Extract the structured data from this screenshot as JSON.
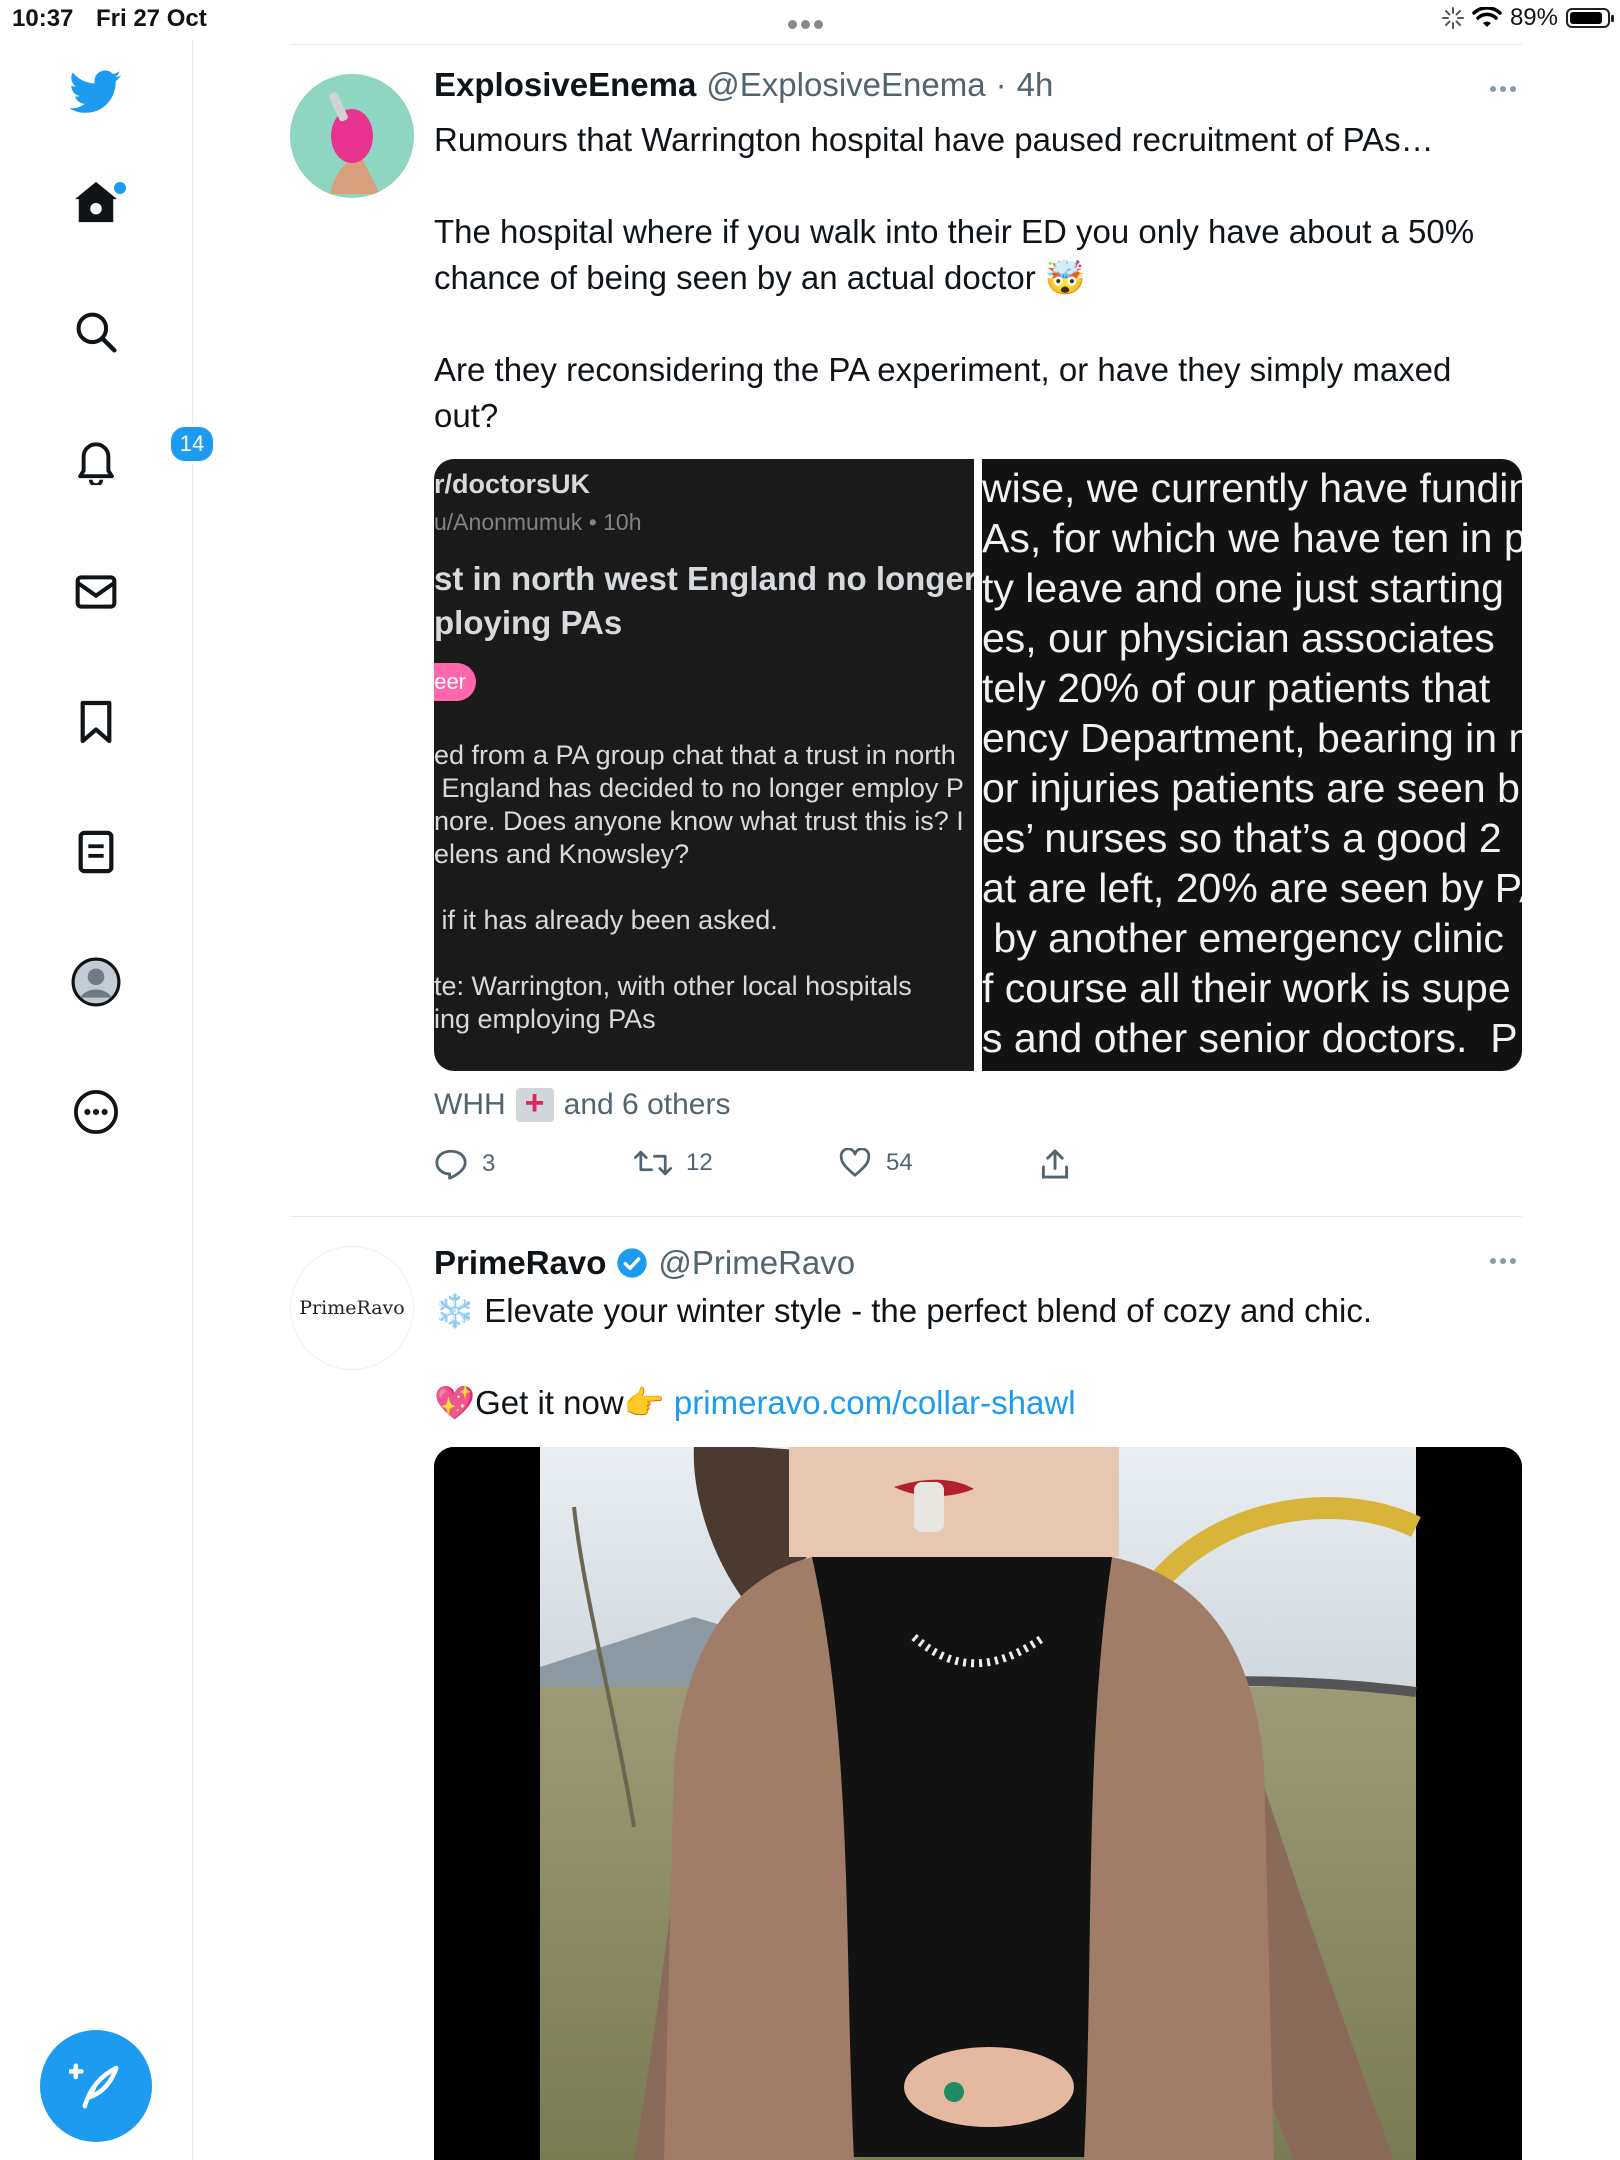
{
  "status_bar": {
    "time": "10:37",
    "date": "Fri 27 Oct",
    "battery": "89%",
    "battery_level": 0.89
  },
  "sidebar": {
    "items": [
      {
        "name": "twitter-logo-icon"
      },
      {
        "name": "home-icon"
      },
      {
        "name": "search-icon"
      },
      {
        "name": "notifications-icon",
        "badge": "14"
      },
      {
        "name": "messages-icon"
      },
      {
        "name": "bookmarks-icon"
      },
      {
        "name": "lists-icon"
      },
      {
        "name": "profile-icon"
      },
      {
        "name": "more-icon"
      }
    ],
    "accent": "#1d9bf0"
  },
  "tweets": [
    {
      "name": "ExplosiveEnema",
      "handle": "@ExplosiveEnema",
      "separator": "·",
      "time": "4h",
      "text": [
        "Rumours that Warrington hospital have paused recruitment of PAs…",
        "The hospital where if you walk into their ED you only have about a 50% chance of being seen by an actual doctor 🤯",
        "Are they reconsidering the PA experiment, or have they simply maxed out?"
      ],
      "media_left": {
        "subreddit": "r/doctorsUK",
        "meta": "u/Anonmumuk • 10h",
        "title": "st in north west England no longer\nploying PAs",
        "flair": "eer",
        "body": "ed from a PA group chat that a trust in north\n England has decided to no longer employ P\nnore. Does anyone know what trust this is? I\nelens and Knowsley?\n\n if it has already been asked.\n\nte: Warrington, with other local hospitals\ning employing PAs"
      },
      "media_right": {
        "text": "wise, we currently have fundin\nAs, for which we have ten in p\nty leave and one just starting\nes, our physician associates\ntely 20% of our patients that\nency Department, bearing in m\nor injuries patients are seen b\nes’ nurses so that’s a good 2\nat are left, 20% are seen by PA\n by another emergency clinic\nf course all their work is supe\ns and other senior doctors.  P"
      },
      "social_context": {
        "prefix": "WHH",
        "suffix": "and 6 others"
      },
      "actions": {
        "replies": "3",
        "retweets": "12",
        "likes": "54"
      }
    },
    {
      "name": "PrimeRavo",
      "handle": "@PrimeRavo",
      "verified": true,
      "avatar_text": "PrimeRavo",
      "text_line1": "❄️ Elevate your winter style - the perfect blend of cozy and chic.",
      "text_line2_prefix": "💖Get it now👉 ",
      "link": "primeravo.com/collar-shawl"
    }
  ]
}
